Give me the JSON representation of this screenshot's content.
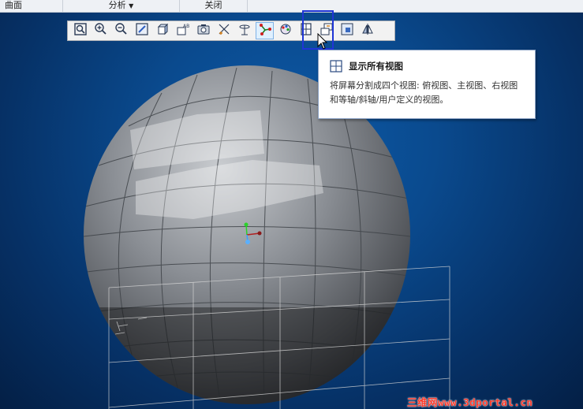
{
  "ribbon": {
    "groups": [
      "曲面",
      "分析",
      "关闭"
    ],
    "dropdown_icon": "caret-down"
  },
  "toolbar": {
    "buttons": [
      {
        "name": "refit-icon"
      },
      {
        "name": "zoom-in-icon"
      },
      {
        "name": "zoom-out-icon"
      },
      {
        "name": "repaint-icon"
      },
      {
        "name": "display-style-icon"
      },
      {
        "name": "saved-orientations-icon"
      },
      {
        "name": "view-manager-icon"
      },
      {
        "name": "datum-display-icon"
      },
      {
        "name": "spin-center-icon"
      },
      {
        "name": "sketch-display-icon"
      },
      {
        "name": "appearance-icon"
      },
      {
        "name": "show-all-views-icon"
      },
      {
        "name": "next-view-icon"
      },
      {
        "name": "view-normal-icon"
      },
      {
        "name": "mirror-view-icon"
      }
    ]
  },
  "tooltip": {
    "title": "显示所有视图",
    "description": "将屏幕分割成四个视图: 俯视图、主视图、右视图和等轴/斜轴/用户定义的视图。",
    "icon": "four-view-icon"
  },
  "watermark": "三维网www.3dportal.cn",
  "colors": {
    "background": "#0a4a8e",
    "highlight_box": "#1f35d6",
    "tooltip_border": "#8aa1c4",
    "watermark": "#ff3a2a"
  }
}
